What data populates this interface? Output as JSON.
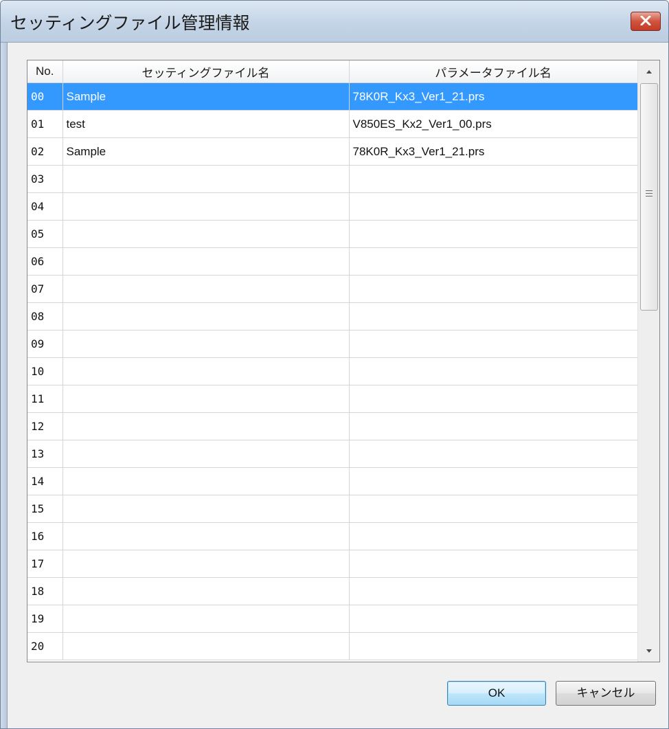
{
  "window": {
    "title": "セッティングファイル管理情報"
  },
  "table": {
    "headers": [
      "No.",
      "セッティングファイル名",
      "パラメータファイル名"
    ],
    "selected_row": 0,
    "rows": [
      {
        "no": "00",
        "setting": "Sample",
        "param": "78K0R_Kx3_Ver1_21.prs"
      },
      {
        "no": "01",
        "setting": "test",
        "param": "V850ES_Kx2_Ver1_00.prs"
      },
      {
        "no": "02",
        "setting": "Sample",
        "param": "78K0R_Kx3_Ver1_21.prs"
      },
      {
        "no": "03",
        "setting": "",
        "param": ""
      },
      {
        "no": "04",
        "setting": "",
        "param": ""
      },
      {
        "no": "05",
        "setting": "",
        "param": ""
      },
      {
        "no": "06",
        "setting": "",
        "param": ""
      },
      {
        "no": "07",
        "setting": "",
        "param": ""
      },
      {
        "no": "08",
        "setting": "",
        "param": ""
      },
      {
        "no": "09",
        "setting": "",
        "param": ""
      },
      {
        "no": "10",
        "setting": "",
        "param": ""
      },
      {
        "no": "11",
        "setting": "",
        "param": ""
      },
      {
        "no": "12",
        "setting": "",
        "param": ""
      },
      {
        "no": "13",
        "setting": "",
        "param": ""
      },
      {
        "no": "14",
        "setting": "",
        "param": ""
      },
      {
        "no": "15",
        "setting": "",
        "param": ""
      },
      {
        "no": "16",
        "setting": "",
        "param": ""
      },
      {
        "no": "17",
        "setting": "",
        "param": ""
      },
      {
        "no": "18",
        "setting": "",
        "param": ""
      },
      {
        "no": "19",
        "setting": "",
        "param": ""
      },
      {
        "no": "20",
        "setting": "",
        "param": ""
      }
    ]
  },
  "buttons": {
    "ok": "OK",
    "cancel": "キャンセル"
  },
  "icons": {
    "close": "close-icon",
    "scroll_up": "scroll-up-arrow-icon",
    "scroll_down": "scroll-down-arrow-icon",
    "grip": "scroll-grip-icon"
  },
  "colors": {
    "selection": "#3399ff",
    "close_button": "#c53b25"
  }
}
